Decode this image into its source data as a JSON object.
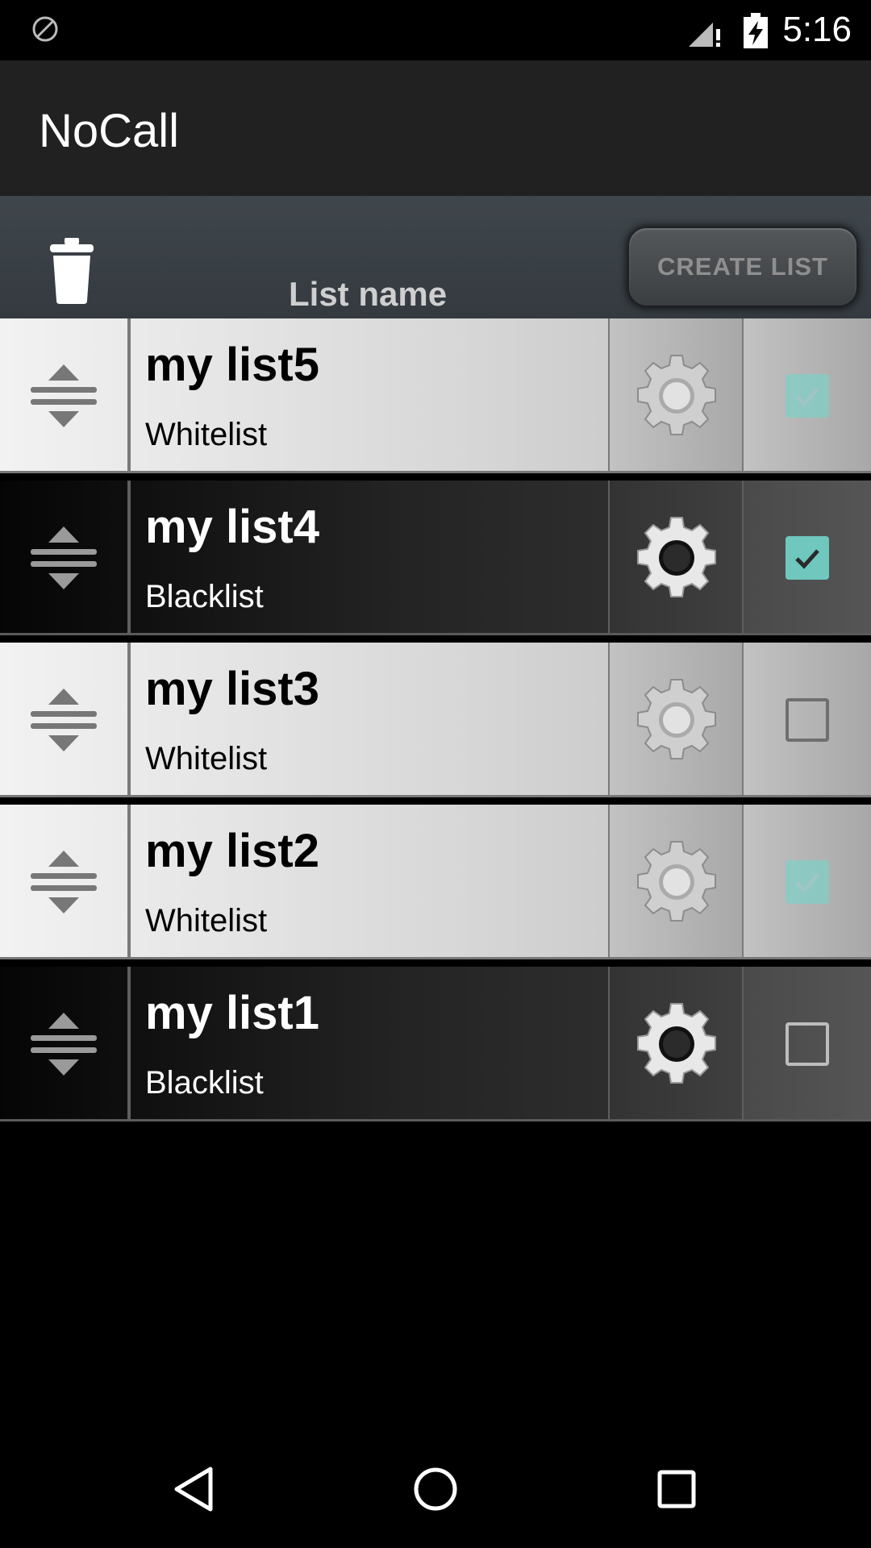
{
  "status_bar": {
    "time": "5:16",
    "icons": [
      "no-sim-icon",
      "signal-icon",
      "battery-charging-icon"
    ]
  },
  "app_bar": {
    "title": "NoCall"
  },
  "header": {
    "delete_icon": "trash-icon",
    "column_label": "List name",
    "create_button_label": "CREATE LIST"
  },
  "lists": [
    {
      "name": "my list5",
      "type": "Whitelist",
      "checked": true,
      "style": "light"
    },
    {
      "name": "my list4",
      "type": "Blacklist",
      "checked": true,
      "style": "dark"
    },
    {
      "name": "my list3",
      "type": "Whitelist",
      "checked": false,
      "style": "light"
    },
    {
      "name": "my list2",
      "type": "Whitelist",
      "checked": true,
      "style": "light"
    },
    {
      "name": "my list1",
      "type": "Blacklist",
      "checked": false,
      "style": "dark"
    }
  ],
  "nav_bar": {
    "icons": [
      "back-icon",
      "home-icon",
      "recents-icon"
    ]
  },
  "colors": {
    "check_accent": "#6fc7bd",
    "app_bar": "#212121",
    "header_bar": "#3f464c"
  }
}
